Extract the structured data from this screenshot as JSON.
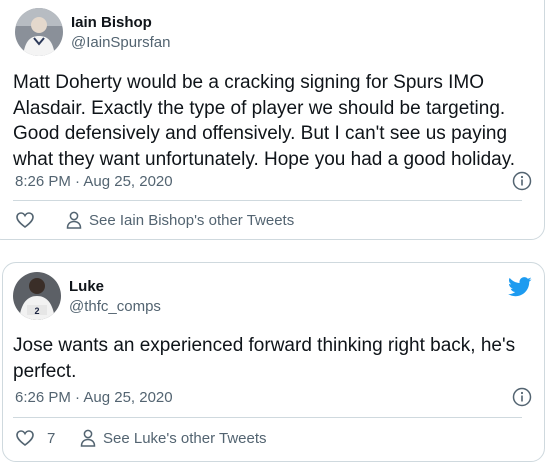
{
  "tweets": [
    {
      "author": {
        "name": "Iain Bishop",
        "handle": "@IainSpursfan",
        "avatar_icon": "profile-photo"
      },
      "text_lines": [
        "Matt Doherty would be a cracking signing for Spurs IMO",
        "Alasdair.  Exactly the type of player we should be targeting.",
        "Good defensively and offensively. But I can't see us paying",
        "what they want unfortunately. Hope you had a good holiday."
      ],
      "timestamp": "8:26 PM · Aug 25, 2020",
      "like_count": "",
      "other_tweets_label": "See Iain Bishop's other Tweets",
      "show_logo": false
    },
    {
      "author": {
        "name": "Luke",
        "handle": "@thfc_comps",
        "avatar_icon": "profile-photo"
      },
      "text_lines": [
        "Jose wants an experienced forward thinking right back, he's",
        "perfect."
      ],
      "timestamp": "6:26 PM · Aug 25, 2020",
      "like_count": "7",
      "other_tweets_label": "See Luke's other Tweets",
      "show_logo": true
    }
  ],
  "icons": {
    "info": "info-icon",
    "like": "heart-icon",
    "profile": "person-icon",
    "logo": "twitter-bird-icon"
  },
  "colors": {
    "border": "#cfd9de",
    "secondary_text": "#536471",
    "twitter_blue": "#1d9bf0"
  }
}
